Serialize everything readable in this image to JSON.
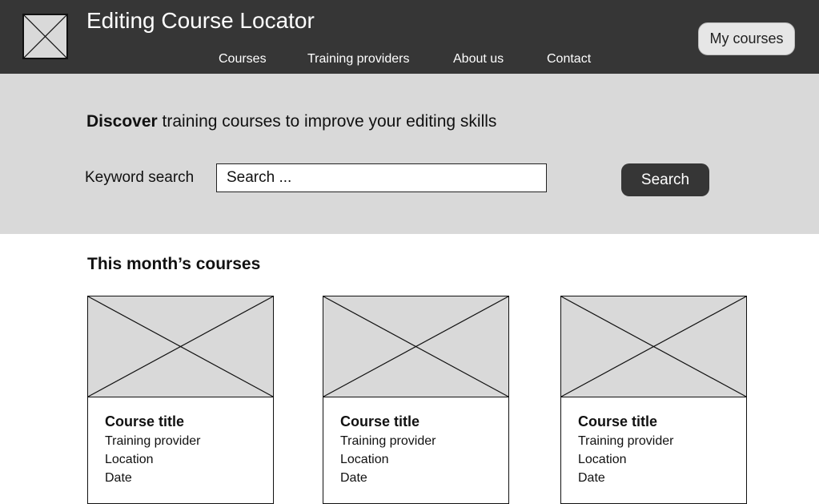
{
  "header": {
    "title": "Editing Course Locator",
    "nav": [
      "Courses",
      "Training providers",
      "About us",
      "Contact"
    ],
    "my_courses_label": "My courses",
    "logo_icon": "image-placeholder-icon"
  },
  "hero": {
    "tagline_bold": "Discover",
    "tagline_rest": " training courses to improve your editing skills",
    "keyword_label": "Keyword search",
    "search_placeholder": "Search ...",
    "search_button": "Search"
  },
  "courses_section": {
    "title": "This month’s courses",
    "cards": [
      {
        "title": "Course title",
        "provider": "Training provider",
        "location": "Location",
        "date": "Date"
      },
      {
        "title": "Course title",
        "provider": "Training provider",
        "location": "Location",
        "date": "Date"
      },
      {
        "title": "Course title",
        "provider": "Training provider",
        "location": "Location",
        "date": "Date"
      }
    ]
  },
  "colors": {
    "header_bg": "#363636",
    "hero_bg": "#d9d9d9",
    "button_dark": "#363636",
    "button_light": "#e6e6e6"
  }
}
